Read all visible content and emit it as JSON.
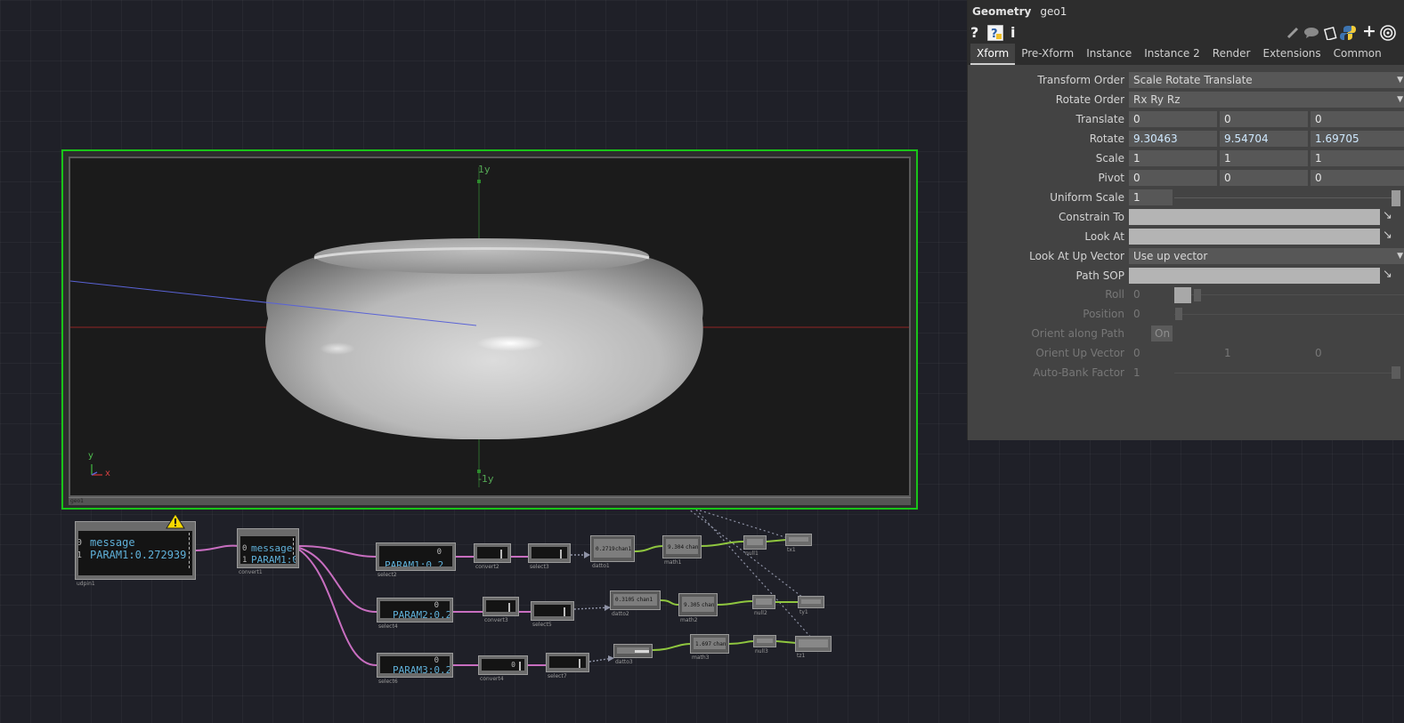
{
  "panel": {
    "op_type": "Geometry",
    "op_name": "geo1",
    "tabs": [
      "Xform",
      "Pre-Xform",
      "Instance",
      "Instance 2",
      "Render",
      "Extensions",
      "Common"
    ],
    "active_tab": "Xform",
    "params": {
      "transform_order": {
        "label": "Transform Order",
        "value": "Scale Rotate Translate"
      },
      "rotate_order": {
        "label": "Rotate Order",
        "value": "Rx Ry Rz"
      },
      "translate": {
        "label": "Translate",
        "x": "0",
        "y": "0",
        "z": "0"
      },
      "rotate": {
        "label": "Rotate",
        "x": "9.30463",
        "y": "9.54704",
        "z": "1.69705"
      },
      "scale": {
        "label": "Scale",
        "x": "1",
        "y": "1",
        "z": "1"
      },
      "pivot": {
        "label": "Pivot",
        "x": "0",
        "y": "0",
        "z": "0"
      },
      "uniform_scale": {
        "label": "Uniform Scale",
        "value": "1"
      },
      "constrain_to": {
        "label": "Constrain To",
        "value": ""
      },
      "look_at": {
        "label": "Look At",
        "value": ""
      },
      "look_at_up_vector": {
        "label": "Look At Up Vector",
        "value": "Use up vector"
      },
      "path_sop": {
        "label": "Path SOP",
        "value": ""
      },
      "roll": {
        "label": "Roll",
        "value": "0"
      },
      "position": {
        "label": "Position",
        "value": "0"
      },
      "orient_along_path": {
        "label": "Orient along Path",
        "value": "On"
      },
      "orient_up_vector": {
        "label": "Orient Up Vector",
        "x": "0",
        "y": "1",
        "z": "0"
      },
      "auto_bank_factor": {
        "label": "Auto-Bank Factor",
        "value": "1"
      }
    }
  },
  "viewer": {
    "label_pos_y": "1y",
    "label_neg_y": "-1y",
    "gizmo_y": "y",
    "gizmo_x": "x",
    "footer": "geo1",
    "colors": {
      "border": "#19c419",
      "x_axis": "#7a2424",
      "y_axis": "#2c6b2c",
      "z_axis": "#5a63d6"
    }
  },
  "network": {
    "udpin": {
      "rows": [
        {
          "idx": "0",
          "text": "message"
        },
        {
          "idx": "1",
          "text": "PARAM1:0.272939"
        }
      ],
      "caption": "udpin1"
    },
    "convert_main": {
      "rows": [
        {
          "idx": "0",
          "text": "message"
        },
        {
          "idx": "1",
          "text": "PARAM1:0."
        }
      ],
      "caption": "convert1"
    },
    "row1": {
      "select": {
        "val": "0",
        "text": "PARAM1:0.2",
        "caption": "select2"
      },
      "convert": {
        "caption": "convert2"
      },
      "select_b": {
        "caption": "select3"
      },
      "datto": {
        "val": "0.2719",
        "chan": "chan1",
        "caption": "datto1"
      },
      "math": {
        "val": "9.304",
        "chan": "chan1",
        "caption": "math1"
      },
      "null": {
        "caption": "null1"
      },
      "out": {
        "caption": "tx1"
      }
    },
    "row2": {
      "select": {
        "val": "0",
        "text": "PARAM2:0.2",
        "caption": "select4"
      },
      "convert": {
        "caption": "convert3"
      },
      "select_b": {
        "caption": "select5"
      },
      "datto": {
        "val": "0.3105",
        "chan": "chan1",
        "caption": "datto2"
      },
      "math": {
        "val": "9.305",
        "chan": "chan1",
        "caption": "math2"
      },
      "null": {
        "caption": "null2"
      },
      "out": {
        "caption": "ty1"
      }
    },
    "row3": {
      "select": {
        "val": "0",
        "text": "PARAM3:0.2",
        "caption": "select6"
      },
      "convert": {
        "val": "0",
        "caption": "convert4"
      },
      "select_b": {
        "caption": "select7"
      },
      "datto": {
        "caption": "datto3"
      },
      "math": {
        "val": "1.697",
        "chan": "chan1",
        "caption": "math3"
      },
      "null": {
        "caption": "null3"
      },
      "out": {
        "caption": "tz1"
      }
    },
    "colors": {
      "dat_wire": "#c86ec0",
      "chop_wire": "#8fc63f",
      "export_wire": "#8f93a6"
    }
  }
}
